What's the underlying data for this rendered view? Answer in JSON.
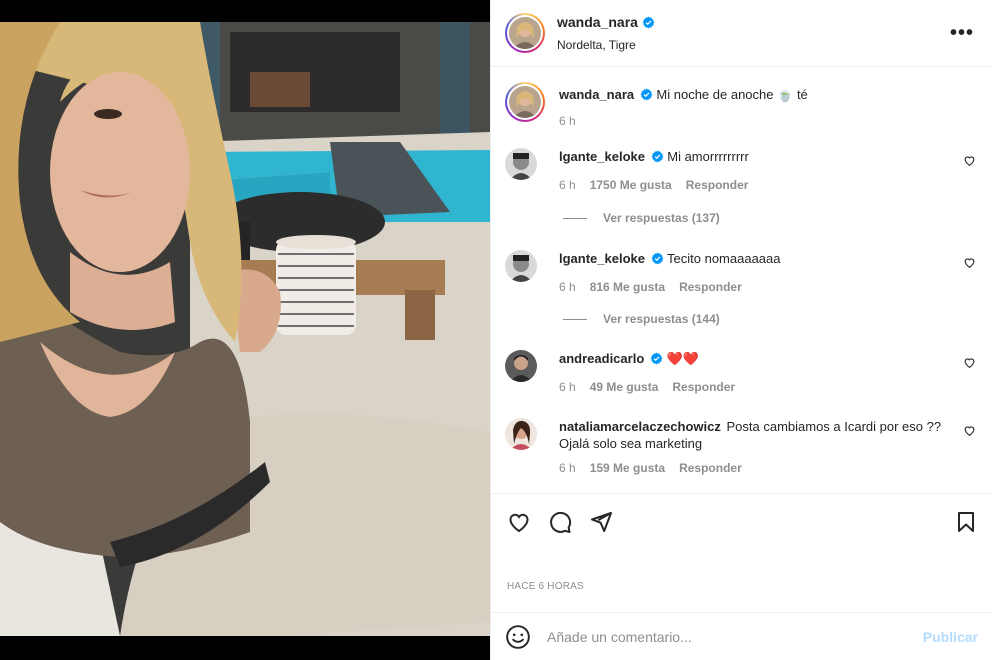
{
  "post": {
    "author": "wanda_nara",
    "location": "Nordelta, Tigre",
    "caption": "Mi noche de anoche",
    "caption_suffix": "té",
    "caption_time": "6 h",
    "time_ago": "HACE 6 HORAS"
  },
  "comments": [
    {
      "user": "lgante_keloke",
      "text": "Mi amorrrrrrrrr",
      "time": "6 h",
      "likes": "1750 Me gusta",
      "reply": "Responder",
      "replies": "Ver respuestas (137)",
      "verified": true
    },
    {
      "user": "lgante_keloke",
      "text": "Tecito nomaaaaaaa",
      "time": "6 h",
      "likes": "816 Me gusta",
      "reply": "Responder",
      "replies": "Ver respuestas (144)",
      "verified": true
    },
    {
      "user": "andreadicarlo",
      "text": "❤️❤️",
      "time": "6 h",
      "likes": "49 Me gusta",
      "reply": "Responder",
      "verified": true
    },
    {
      "user": "nataliamarcelaczechowicz",
      "text": "Posta cambiamos a Icardi por eso ?? Ojalá solo sea marketing",
      "time": "6 h",
      "likes": "159 Me gusta",
      "reply": "Responder",
      "verified": false
    }
  ],
  "composer": {
    "placeholder": "Añade un comentario...",
    "publish_label": "Publicar"
  },
  "icons": {
    "more": "more-options-icon",
    "like": "heart-icon",
    "comment": "comment-icon",
    "share": "paper-plane-icon",
    "save": "bookmark-icon",
    "emoji": "emoji-icon",
    "verified": "verified-badge-icon"
  },
  "colors": {
    "verified_blue": "#0095f6",
    "publish_disabled": "#b3dbff",
    "meta_gray": "#8e8e8e"
  }
}
